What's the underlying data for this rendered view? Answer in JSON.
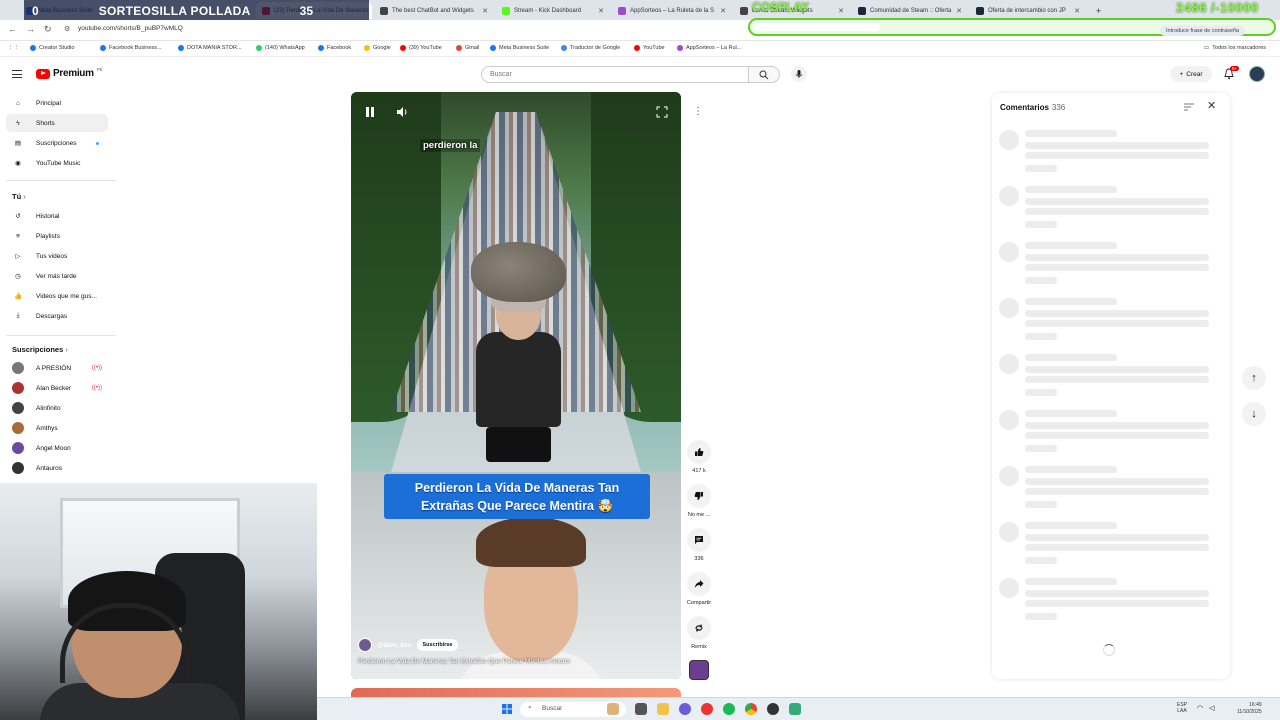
{
  "browser": {
    "tabs": [
      {
        "label": "Meta Business Suite",
        "color": "#1877f2"
      },
      {
        "label": "(23) Perdieron La Vida De Maneras",
        "color": "#f00"
      },
      {
        "label": "The best ChatBot and Widgets",
        "color": "#444"
      },
      {
        "label": "Stream - Kick Dashboard",
        "color": "#53fc18"
      },
      {
        "label": "AppSorteos – La Ruleta de la S",
        "color": "#9b4dca"
      },
      {
        "label": "Lumia Stream Widgets",
        "color": "#444"
      },
      {
        "label": "Comunidad de Steam :: Oferta",
        "color": "#1b2838"
      },
      {
        "label": "Oferta de intercambio con JP",
        "color": "#1b2838"
      }
    ],
    "url": "youtube.com/shorts/B_puBP7wMLQ",
    "password_hint": "Introduce frase de contraseña",
    "bookmarks": [
      {
        "label": "Creator Studio",
        "color": "#1877f2"
      },
      {
        "label": "Facebook Business...",
        "color": "#1877f2"
      },
      {
        "label": "DOTA MANIA STOR...",
        "color": "#1877f2"
      },
      {
        "label": "(140) WhatsApp",
        "color": "#25d366"
      },
      {
        "label": "Facebook",
        "color": "#1877f2"
      },
      {
        "label": "Google",
        "color": "#fbbc05"
      },
      {
        "label": "(39) YouTube",
        "color": "#f00"
      },
      {
        "label": "Gmail",
        "color": "#ea4335"
      },
      {
        "label": "Meta Business Suite",
        "color": "#1877f2"
      },
      {
        "label": "Traductor de Google",
        "color": "#4285f4"
      },
      {
        "label": "YouTube",
        "color": "#f00"
      },
      {
        "label": "AppSorteos – La Rul...",
        "color": "#9b4dca"
      }
    ],
    "all_bookmarks": "Todos los marcadores"
  },
  "overlay": {
    "left_number": "0",
    "title": "SORTEOSILLA POLLADA",
    "right_number": "35",
    "cosplay": "COSPLAY",
    "score": "2486 /-10000"
  },
  "header": {
    "logo_word": "Premium",
    "logo_country": "PE",
    "search_placeholder": "Buscar",
    "create_label": "Crear",
    "notifications": "9+"
  },
  "sidebar": {
    "main": [
      {
        "label": "Principal",
        "icon": "home-icon"
      },
      {
        "label": "Shorts",
        "icon": "shorts-icon"
      },
      {
        "label": "Suscripciones",
        "icon": "subscriptions-icon"
      },
      {
        "label": "YouTube Music",
        "icon": "music-icon"
      }
    ],
    "you_title": "Tú",
    "you": [
      {
        "label": "Historial",
        "icon": "history-icon"
      },
      {
        "label": "Playlists",
        "icon": "playlist-icon"
      },
      {
        "label": "Tus videos",
        "icon": "video-icon"
      },
      {
        "label": "Ver más tarde",
        "icon": "clock-icon"
      },
      {
        "label": "Videos que me gus...",
        "icon": "like-icon"
      },
      {
        "label": "Descargas",
        "icon": "download-icon"
      }
    ],
    "subs_title": "Suscripciones",
    "subs": [
      {
        "label": "A PRESIÓN",
        "live": true,
        "color": "#777"
      },
      {
        "label": "Alan Becker",
        "live": true,
        "color": "#a33"
      },
      {
        "label": "Alinfinito",
        "live": false,
        "color": "#444"
      },
      {
        "label": "Amthys",
        "live": false,
        "color": "#a86b3c"
      },
      {
        "label": "Angel Moon",
        "live": false,
        "color": "#6b4aa0"
      },
      {
        "label": "Antauros",
        "live": false,
        "color": "#333"
      }
    ]
  },
  "short": {
    "caption_top": "perdieron la",
    "caption_big_line1": "Perdieron La Vida De Maneras Tan",
    "caption_big_line2": "Extrañas Que Parece Mentira 🤯",
    "channel": "@dani_itss",
    "subscribe": "Suscribirse",
    "title": "Perdieron La Vida De Maneras Tan Extrañas Que Parece Mentira #shorts"
  },
  "actions": {
    "likes": "417 k",
    "dislike": "No me ...",
    "comments": "336",
    "share": "Compartir",
    "remix": "Remix"
  },
  "comments_panel": {
    "title": "Comentarios",
    "count": "336"
  },
  "taskbar": {
    "search": "Buscar",
    "lang1": "ESP",
    "lang2": "LAA",
    "time": "16:49",
    "date": "11/10/2025"
  }
}
